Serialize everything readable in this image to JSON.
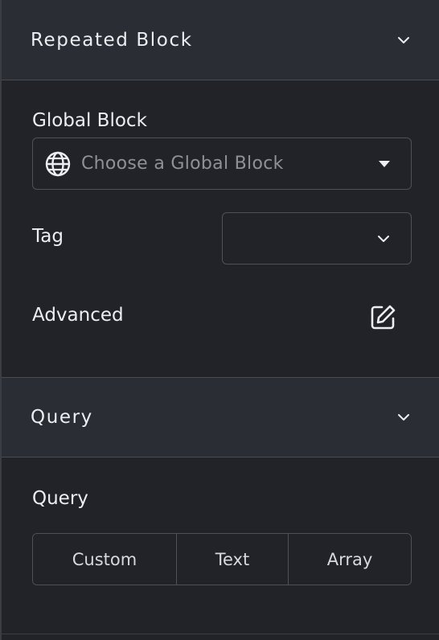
{
  "sections": {
    "repeated_block": {
      "title": "Repeated Block",
      "chevron_icon": "chevron-down-icon"
    },
    "query": {
      "title": "Query",
      "chevron_icon": "chevron-down-icon"
    }
  },
  "global_block": {
    "label": "Global Block",
    "placeholder": "Choose a Global Block",
    "icon": "globe-icon",
    "dropdown_icon": "caret-down-icon"
  },
  "tag": {
    "label": "Tag",
    "value": "",
    "dropdown_icon": "chevron-down-icon"
  },
  "advanced": {
    "label": "Advanced",
    "icon": "edit-icon"
  },
  "query_field": {
    "label": "Query",
    "options": [
      "Custom",
      "Text",
      "Array"
    ]
  },
  "colors": {
    "background": "#212328",
    "header_background": "#2a2d34",
    "border": "#4e5159",
    "text": "#eceef1",
    "placeholder": "#8e9198"
  }
}
